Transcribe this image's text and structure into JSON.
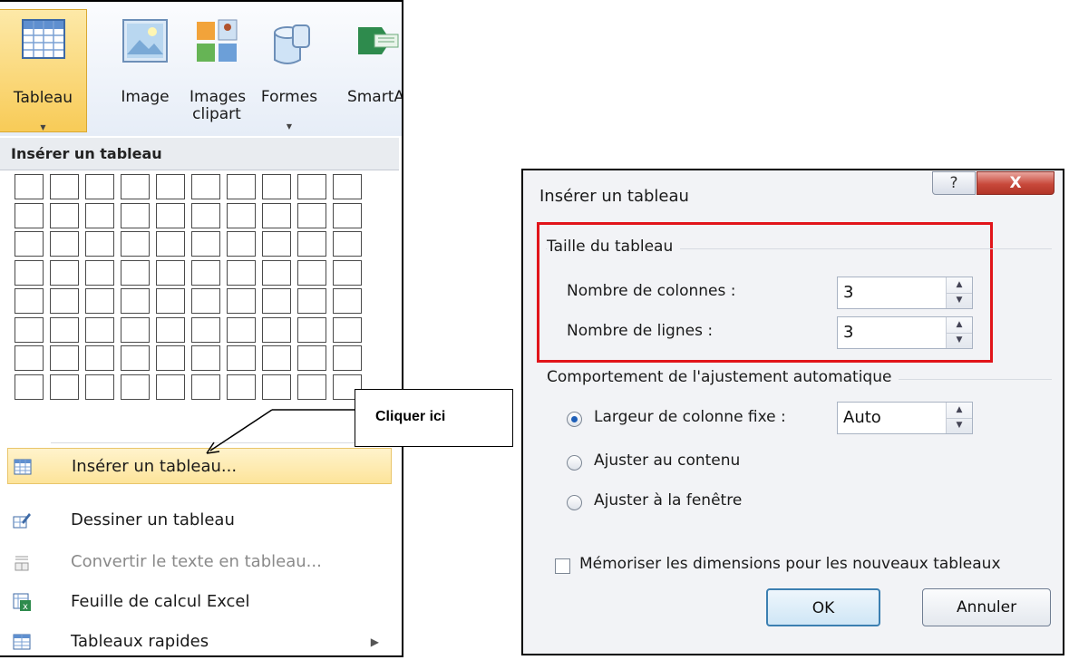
{
  "ribbon": {
    "buttons": [
      {
        "label": "Tableau",
        "icon": "table-icon"
      },
      {
        "label": "Image",
        "icon": "image-icon"
      },
      {
        "label": "Images clipart",
        "icon": "clipart-icon"
      },
      {
        "label": "Formes",
        "icon": "shapes-icon"
      },
      {
        "label": "SmartA",
        "icon": "smartart-icon"
      }
    ]
  },
  "menu": {
    "header": "Insérer un tableau",
    "grid": {
      "columns": 10,
      "rows": 8
    },
    "items": [
      {
        "label": "Insérer un tableau...",
        "icon": "table-icon",
        "state": "highlighted"
      },
      {
        "label": "Dessiner un tableau",
        "icon": "pencil-table-icon"
      },
      {
        "label": "Convertir le texte en tableau...",
        "icon": "convert-text-icon",
        "state": "disabled"
      },
      {
        "label": "Feuille de calcul Excel",
        "icon": "excel-icon"
      },
      {
        "label": "Tableaux rapides",
        "icon": "quick-tables-icon",
        "submenu": true
      }
    ]
  },
  "callout": {
    "text": "Cliquer ici"
  },
  "dialog": {
    "title": "Insérer un tableau",
    "help_label": "?",
    "close_label": "X",
    "group_size": {
      "title": "Taille du tableau",
      "columns_label": "Nombre de colonnes :",
      "columns_value": "3",
      "rows_label": "Nombre de lignes :",
      "rows_value": "3"
    },
    "group_autofit": {
      "title": "Comportement de l'ajustement automatique",
      "option_fixed": "Largeur de colonne fixe :",
      "fixed_value": "Auto",
      "option_content": "Ajuster au contenu",
      "option_window": "Ajuster à la fenêtre",
      "selected": "option_fixed"
    },
    "remember_label": "Mémoriser les dimensions pour les nouveaux tableaux",
    "remember_checked": false,
    "ok_label": "OK",
    "cancel_label": "Annuler",
    "highlight_color": "#e1141a"
  }
}
